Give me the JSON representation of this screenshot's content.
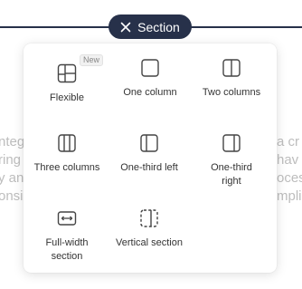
{
  "pill": {
    "label": "Section",
    "close_icon": "close-icon"
  },
  "background_text": {
    "left_lines": [
      "nteg",
      "ring",
      "y an",
      "onsil"
    ],
    "right_lines": [
      "a cr",
      "hav",
      "oces",
      "mplia"
    ]
  },
  "menu": {
    "options": [
      {
        "label": "Flexible",
        "icon": "flexible-layout-icon",
        "badge": "New"
      },
      {
        "label": "One column",
        "icon": "one-column-icon"
      },
      {
        "label": "Two columns",
        "icon": "two-columns-icon"
      },
      {
        "label": "Three columns",
        "icon": "three-columns-icon"
      },
      {
        "label": "One-third left",
        "icon": "one-third-left-icon"
      },
      {
        "label": "One-third right",
        "icon": "one-third-right-icon"
      },
      {
        "label": "Full-width section",
        "icon": "full-width-icon"
      },
      {
        "label": "Vertical section",
        "icon": "vertical-section-icon"
      }
    ]
  },
  "colors": {
    "pill": "#27314a",
    "text": "#333333"
  }
}
